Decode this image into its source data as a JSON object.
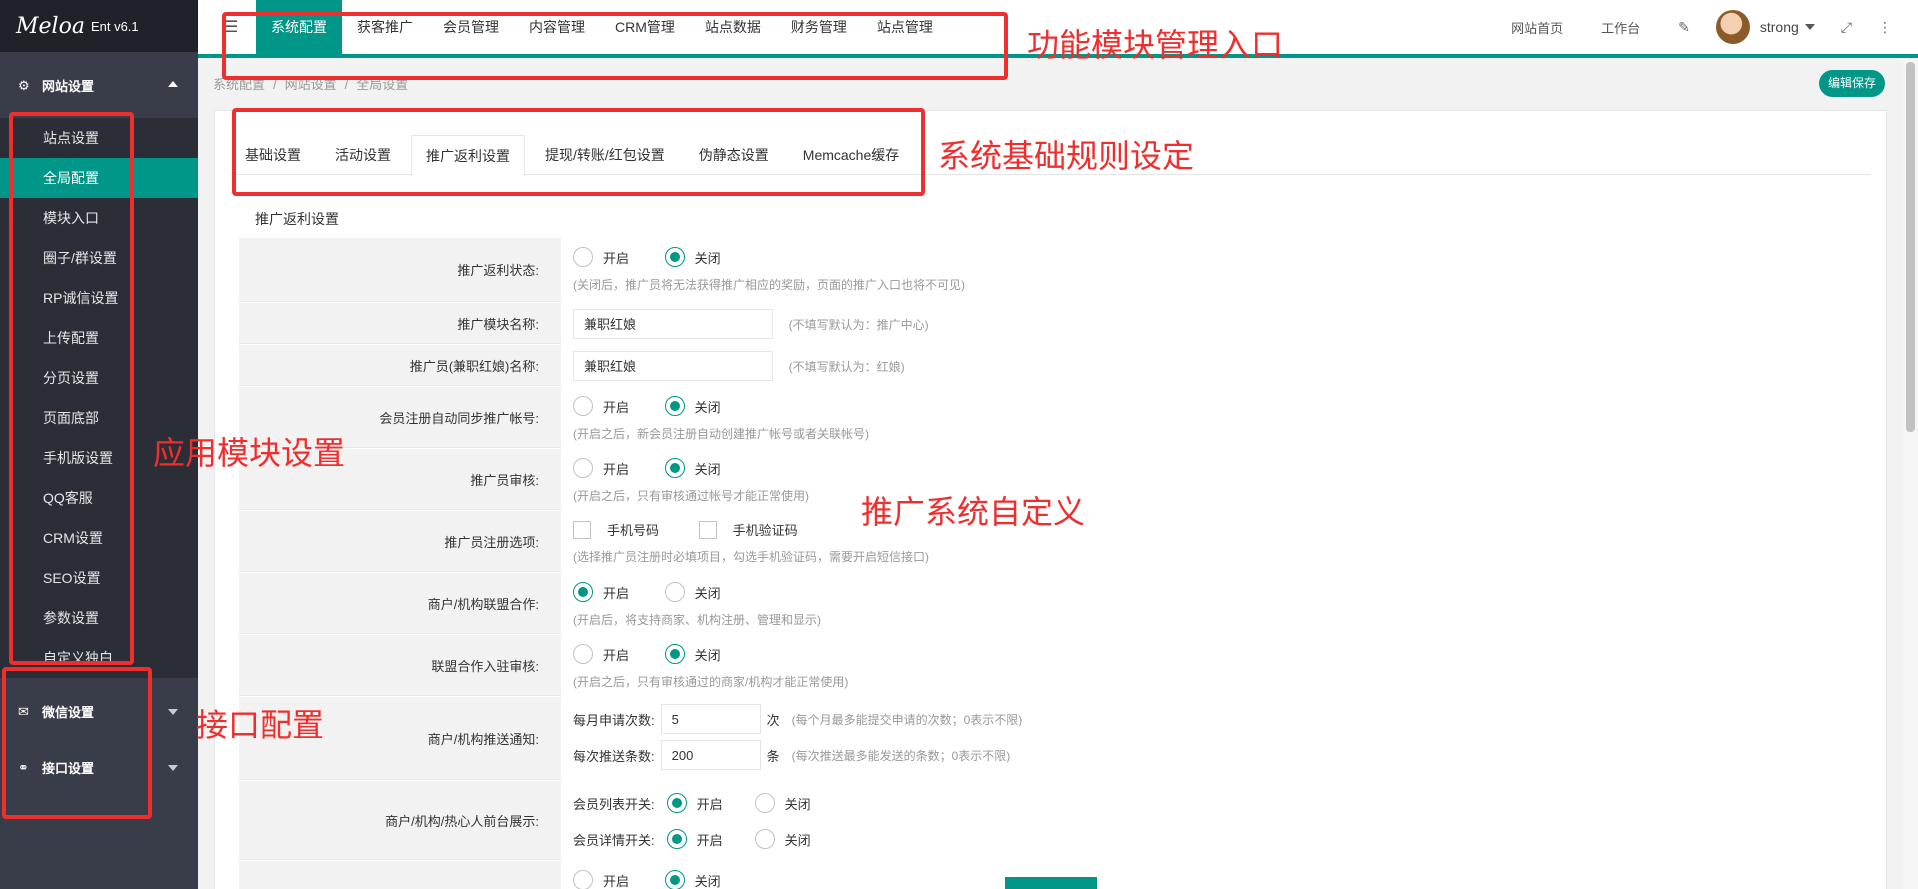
{
  "sidebar": {
    "logo_mark": "Meloa",
    "logo_text": "Ent v6.1",
    "group_site": "网站设置",
    "items": [
      {
        "label": "站点设置",
        "active": false
      },
      {
        "label": "全局配置",
        "active": true
      },
      {
        "label": "模块入口",
        "active": false
      },
      {
        "label": "圈子/群设置",
        "active": false
      },
      {
        "label": "RP诚信设置",
        "active": false
      },
      {
        "label": "上传配置",
        "active": false
      },
      {
        "label": "分页设置",
        "active": false
      },
      {
        "label": "页面底部",
        "active": false
      },
      {
        "label": "手机版设置",
        "active": false
      },
      {
        "label": "QQ客服",
        "active": false
      },
      {
        "label": "CRM设置",
        "active": false
      },
      {
        "label": "SEO设置",
        "active": false
      },
      {
        "label": "参数设置",
        "active": false
      },
      {
        "label": "自定义独白",
        "active": false
      }
    ],
    "group_wechat": "微信设置",
    "group_api": "接口设置"
  },
  "topbar": {
    "menu_icon": "☰",
    "nav": [
      "系统配置",
      "获客推广",
      "会员管理",
      "内容管理",
      "CRM管理",
      "站点数据",
      "财务管理",
      "站点管理"
    ],
    "site_home": "网站首页",
    "workbench": "工作台",
    "username": "strong"
  },
  "breadcrumb": [
    "系统配置",
    "网站设置",
    "全局设置"
  ],
  "save_button": "编辑保存",
  "tabs": [
    "基础设置",
    "活动设置",
    "推广返利设置",
    "提现/转账/红包设置",
    "伪静态设置",
    "Memcache缓存"
  ],
  "section_title": "推广返利设置",
  "form": {
    "r1_label": "推广返利状态:",
    "r1_on": "开启",
    "r1_off": "关闭",
    "r1_hint": "(关闭后，推广员将无法获得推广相应的奖励，页面的推广入口也将不可见)",
    "r2_label": "推广模块名称:",
    "r2_value": "兼职红娘",
    "r2_hint": "(不填写默认为：推广中心)",
    "r3_label": "推广员(兼职红娘)名称:",
    "r3_value": "兼职红娘",
    "r3_hint": "(不填写默认为：红娘)",
    "r4_label": "会员注册自动同步推广帐号:",
    "r4_on": "开启",
    "r4_off": "关闭",
    "r4_hint": "(开启之后，新会员注册自动创建推广帐号或者关联帐号)",
    "r5_label": "推广员审核:",
    "r5_on": "开启",
    "r5_off": "关闭",
    "r5_hint": "(开启之后，只有审核通过帐号才能正常使用)",
    "r6_label": "推广员注册选项:",
    "r6_opt1": "手机号码",
    "r6_opt2": "手机验证码",
    "r6_hint": "(选择推广员注册时必填项目，勾选手机验证码，需要开启短信接口)",
    "r7_label": "商户/机构联盟合作:",
    "r7_on": "开启",
    "r7_off": "关闭",
    "r7_hint": "(开启后，将支持商家、机构注册、管理和显示)",
    "r8_label": "联盟合作入驻审核:",
    "r8_on": "开启",
    "r8_off": "关闭",
    "r8_hint": "(开启之后，只有审核通过的商家/机构才能正常使用)",
    "r9_label": "商户/机构推送通知:",
    "r9_a_label": "每月申请次数:",
    "r9_a_value": "5",
    "r9_a_unit": "次",
    "r9_a_hint": "(每个月最多能提交申请的次数；0表示不限)",
    "r9_b_label": "每次推送条数:",
    "r9_b_value": "200",
    "r9_b_unit": "条",
    "r9_b_hint": "(每次推送最多能发送的条数；0表示不限)",
    "r10_label": "商户/机构/热心人前台展示:",
    "r10_a_label": "会员列表开关:",
    "r10_a_on": "开启",
    "r10_a_off": "关闭",
    "r10_b_label": "会员详情开关:",
    "r10_b_on": "开启",
    "r10_b_off": "关闭",
    "r11_on": "开启",
    "r11_off": "关闭"
  },
  "annotations": {
    "top": "功能模块管理入口",
    "tabs": "系统基础规则设定",
    "sidebar": "应用模块设置",
    "form": "推广系统自定义",
    "api": "接口配置"
  },
  "colors": {
    "accent": "#009688",
    "sidebar": "#393d49",
    "annotation": "#ef2e2e"
  }
}
